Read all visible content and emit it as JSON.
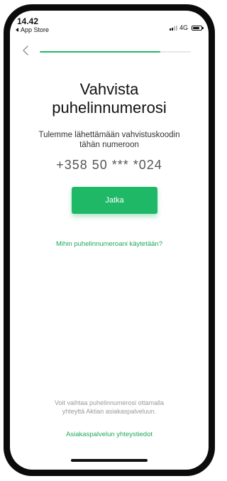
{
  "status_bar": {
    "time": "14.42",
    "back_app": "App Store",
    "network": "4G"
  },
  "progress": {
    "fraction": 0.8
  },
  "main": {
    "title_line1": "Vahvista",
    "title_line2": "puhelinnumerosi",
    "subtitle_line1": "Tulemme lähettämään vahvistuskoodin",
    "subtitle_line2": "tähän numeroon",
    "phone_number": "+358 50 *** *024",
    "continue_label": "Jatka",
    "why_link": "Mihin puhelinnumeroani käytetään?"
  },
  "footer": {
    "info_line1": "Voit vaihtaa puhelinnumerosi ottamalla",
    "info_line2": "yhteyttä Aktian asiakaspalveluun.",
    "customer_service_link": "Asiakaspalvelun yhteystiedot"
  },
  "colors": {
    "accent": "#1fb866",
    "link": "#1fa85d",
    "frame": "#0b0b0b"
  },
  "icons": {
    "back": "chevron-left-icon",
    "signal": "signal-icon",
    "battery": "battery-icon"
  }
}
